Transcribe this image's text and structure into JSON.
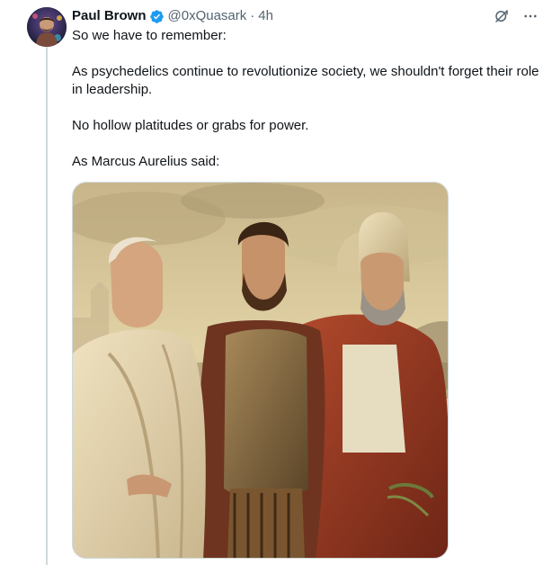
{
  "tweet": {
    "author_name": "Paul Brown",
    "verified": true,
    "handle": "@0xQuasark",
    "separator": "·",
    "time": "4h",
    "paragraphs": [
      "So we have to remember:",
      "As psychedelics continue to revolutionize society, we shouldn't forget their role in leadership.",
      "No hollow platitudes or grabs for power.",
      "As Marcus Aurelius said:"
    ],
    "media": {
      "type": "image",
      "subject": "painting of three classical Roman figures"
    }
  },
  "icons": {
    "verified": "verified-badge-icon",
    "grok": "grok-icon",
    "more": "more-options-icon"
  },
  "colors": {
    "accent": "#1d9bf0",
    "text_primary": "#0f1419",
    "text_secondary": "#536471",
    "thread_line": "#cfd9de"
  }
}
